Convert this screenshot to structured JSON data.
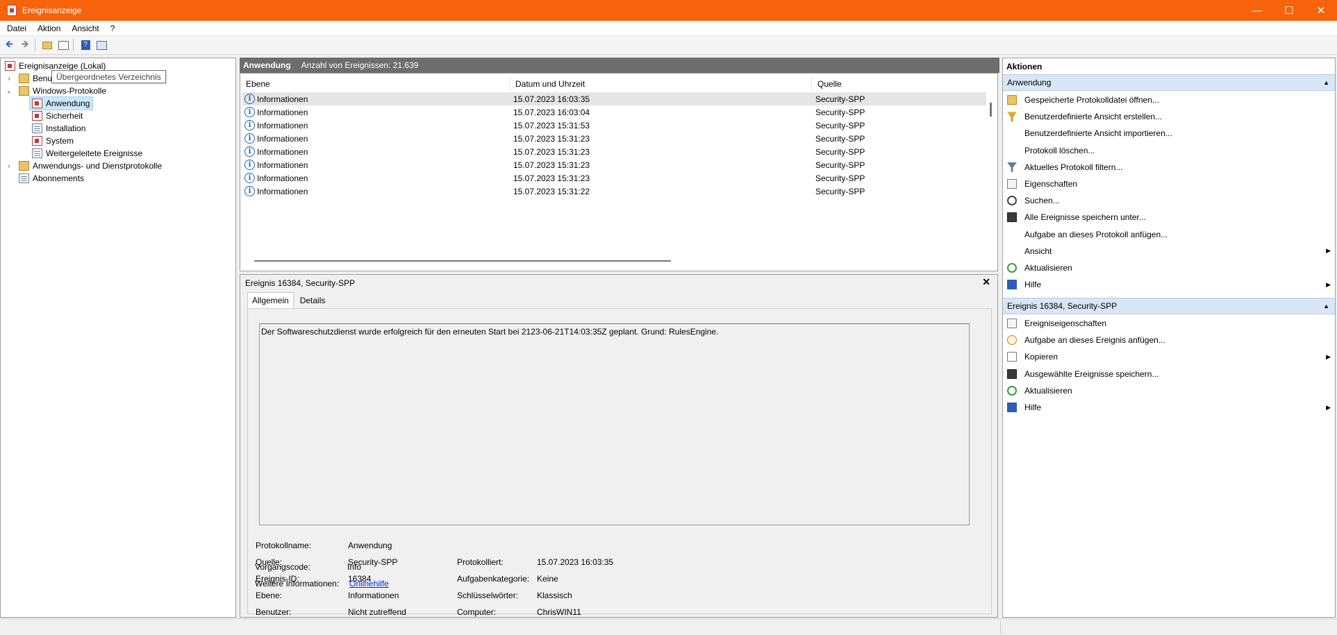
{
  "window": {
    "title": "Ereignisanzeige"
  },
  "menu": [
    "Datei",
    "Aktion",
    "Ansicht",
    "?"
  ],
  "tree": {
    "root": "Ereignisanzeige (Lokal)",
    "custom_views_partial": "Benu",
    "windows_logs": "Windows-Protokolle",
    "logs": [
      "Anwendung",
      "Sicherheit",
      "Installation",
      "System",
      "Weitergeleitete Ereignisse"
    ],
    "app_service_logs": "Anwendungs- und Dienstprotokolle",
    "subscriptions": "Abonnements"
  },
  "tooltip": "Übergeordnetes Verzeichnis",
  "list": {
    "log_name": "Anwendung",
    "count_text": "Anzahl von Ereignissen: 21.639",
    "columns": [
      "Ebene",
      "Datum und Uhrzeit",
      "Quelle"
    ],
    "rows": [
      {
        "level": "Informationen",
        "datetime": "15.07.2023 16:03:35",
        "source": "Security-SPP"
      },
      {
        "level": "Informationen",
        "datetime": "15.07.2023 16:03:04",
        "source": "Security-SPP"
      },
      {
        "level": "Informationen",
        "datetime": "15.07.2023 15:31:53",
        "source": "Security-SPP"
      },
      {
        "level": "Informationen",
        "datetime": "15.07.2023 15:31:23",
        "source": "Security-SPP"
      },
      {
        "level": "Informationen",
        "datetime": "15.07.2023 15:31:23",
        "source": "Security-SPP"
      },
      {
        "level": "Informationen",
        "datetime": "15.07.2023 15:31:23",
        "source": "Security-SPP"
      },
      {
        "level": "Informationen",
        "datetime": "15.07.2023 15:31:23",
        "source": "Security-SPP"
      },
      {
        "level": "Informationen",
        "datetime": "15.07.2023 15:31:22",
        "source": "Security-SPP"
      }
    ]
  },
  "detail": {
    "title": "Ereignis 16384, Security-SPP",
    "tabs": [
      "Allgemein",
      "Details"
    ],
    "message": "Der Softwareschutzdienst wurde erfolgreich für den erneuten Start bei 2123-06-21T14:03:35Z geplant. Grund: RulesEngine.",
    "labels": {
      "log_name": "Protokollname:",
      "source": "Quelle:",
      "event_id": "Ereignis-ID:",
      "level": "Ebene:",
      "user": "Benutzer:",
      "opcode": "Vorgangscode:",
      "more_info": "Weitere Informationen:",
      "logged": "Protokolliert:",
      "task_category": "Aufgabenkategorie:",
      "keywords": "Schlüsselwörter:",
      "computer": "Computer:"
    },
    "values": {
      "log_name": "Anwendung",
      "source": "Security-SPP",
      "event_id": "16384",
      "level": "Informationen",
      "user": "Nicht zutreffend",
      "opcode": "Info",
      "more_info": "Onlinehilfe",
      "logged": "15.07.2023 16:03:35",
      "task_category": "Keine",
      "keywords": "Klassisch",
      "computer": "ChrisWIN11"
    }
  },
  "actions": {
    "title": "Aktionen",
    "section1": "Anwendung",
    "items1": [
      {
        "label": "Gespeicherte Protokolldatei öffnen...",
        "icon": "open-folder-icon"
      },
      {
        "label": "Benutzerdefinierte Ansicht erstellen...",
        "icon": "filter-create-icon"
      },
      {
        "label": "Benutzerdefinierte Ansicht importieren...",
        "icon": ""
      },
      {
        "label": "Protokoll löschen...",
        "icon": ""
      },
      {
        "label": "Aktuelles Protokoll filtern...",
        "icon": "filter-icon"
      },
      {
        "label": "Eigenschaften",
        "icon": "properties-icon"
      },
      {
        "label": "Suchen...",
        "icon": "binoculars-icon"
      },
      {
        "label": "Alle Ereignisse speichern unter...",
        "icon": "save-icon"
      },
      {
        "label": "Aufgabe an dieses Protokoll anfügen...",
        "icon": ""
      },
      {
        "label": "Ansicht",
        "icon": "",
        "submenu": true
      },
      {
        "label": "Aktualisieren",
        "icon": "refresh-icon"
      },
      {
        "label": "Hilfe",
        "icon": "help-icon",
        "submenu": true
      }
    ],
    "section2": "Ereignis 16384, Security-SPP",
    "items2": [
      {
        "label": "Ereigniseigenschaften",
        "icon": "properties-icon"
      },
      {
        "label": "Aufgabe an dieses Ereignis anfügen...",
        "icon": "task-icon"
      },
      {
        "label": "Kopieren",
        "icon": "copy-icon",
        "submenu": true
      },
      {
        "label": "Ausgewählte Ereignisse speichern...",
        "icon": "save-icon"
      },
      {
        "label": "Aktualisieren",
        "icon": "refresh-icon"
      },
      {
        "label": "Hilfe",
        "icon": "help-icon",
        "submenu": true
      }
    ]
  }
}
